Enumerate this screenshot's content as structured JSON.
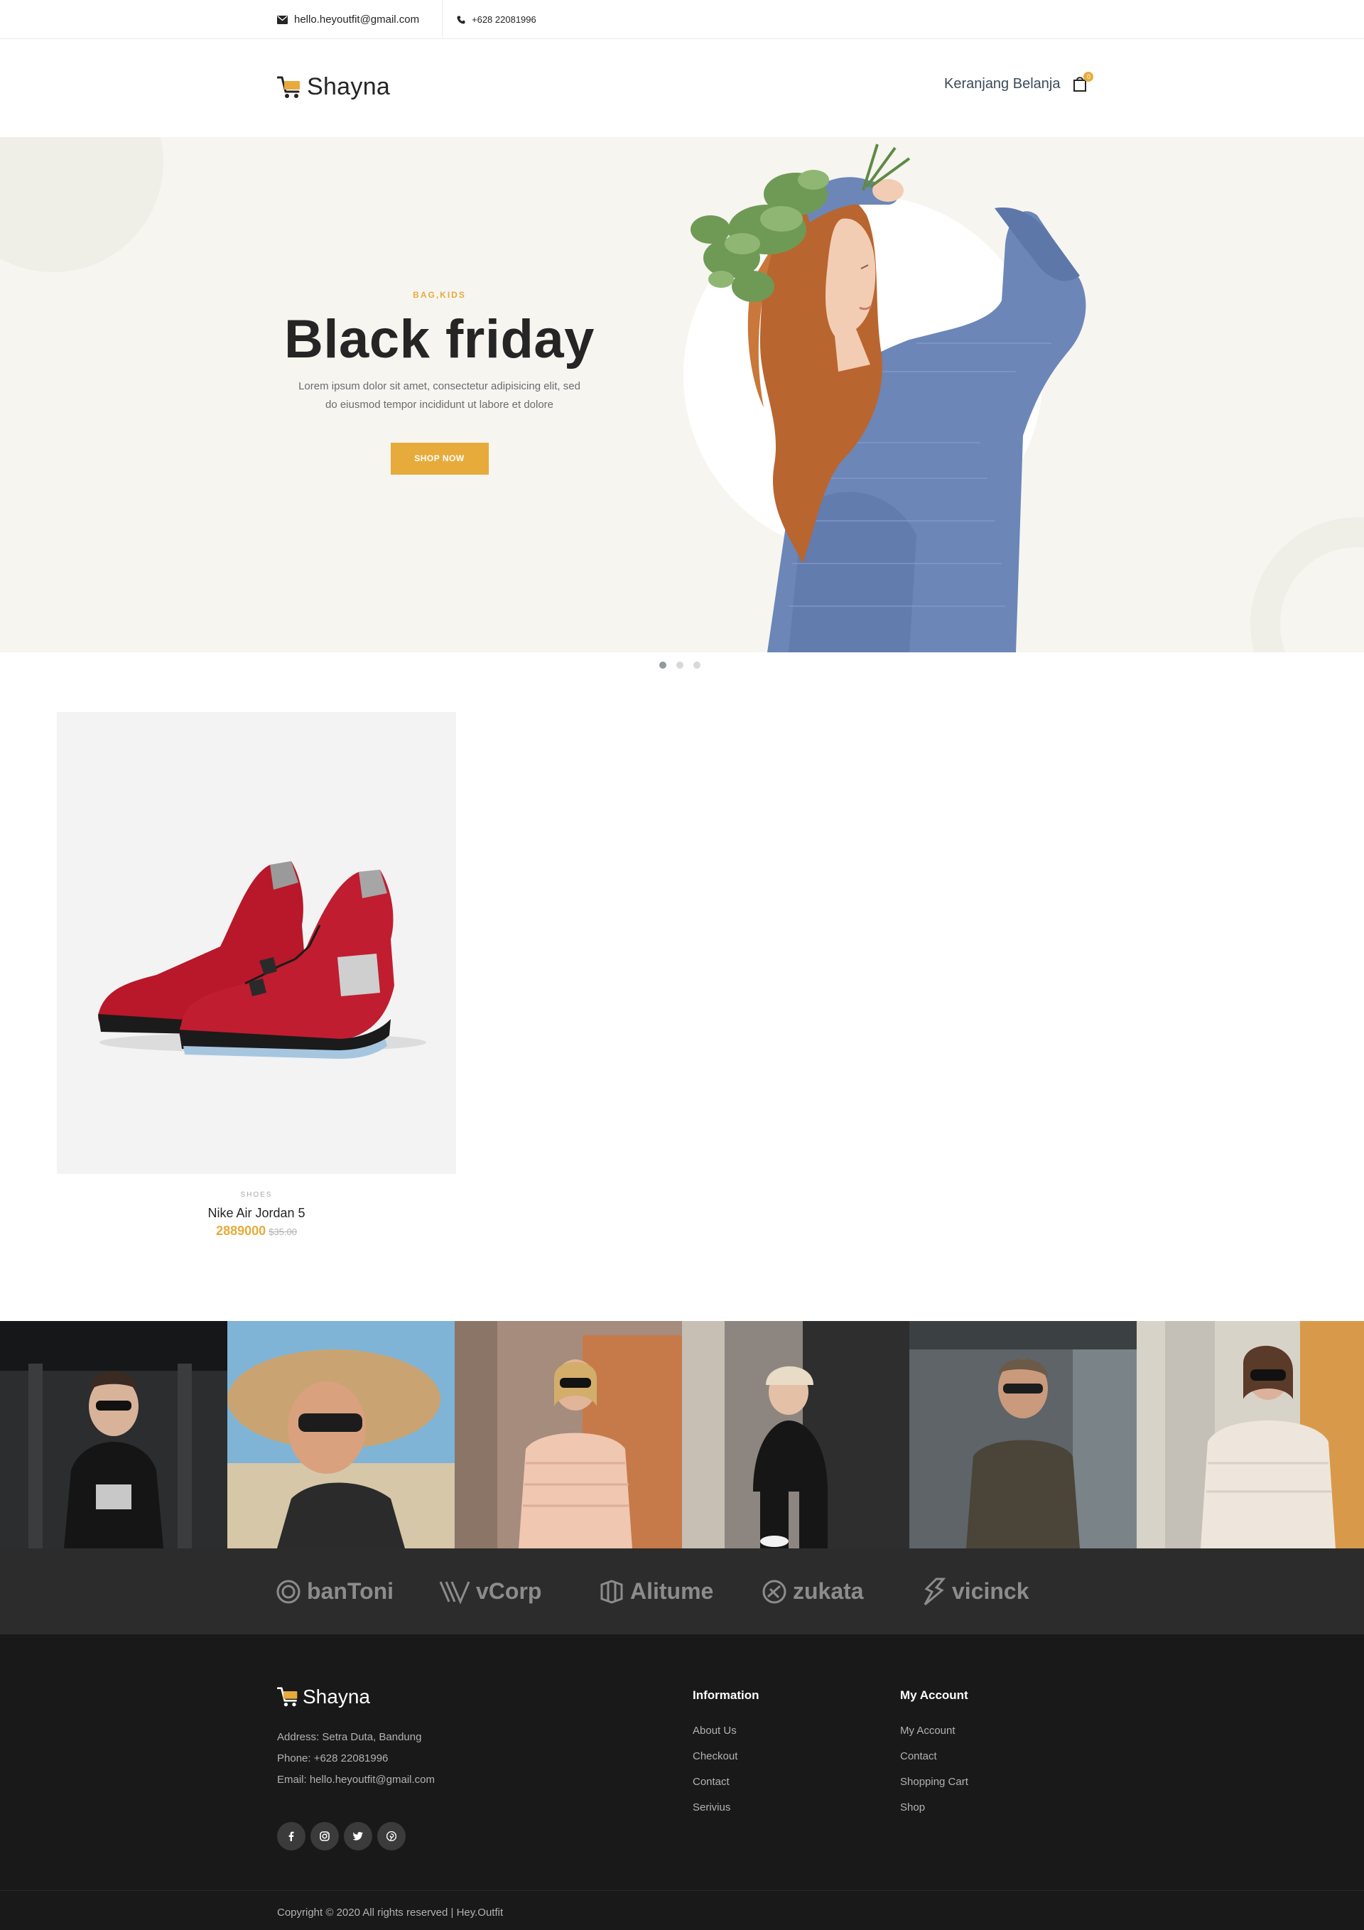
{
  "topbar": {
    "email": "hello.heyoutfit@gmail.com",
    "phone": "+628 22081996"
  },
  "header": {
    "logo_text": "Shayna",
    "cart_label": "Keranjang Belanja",
    "cart_count": "0"
  },
  "hero": {
    "category": "BAG,KIDS",
    "title": "Black friday",
    "description_line1": "Lorem ipsum dolor sit amet, consectetur adipisicing elit, sed",
    "description_line2": "do eiusmod tempor incididunt ut labore et dolore",
    "button_label": "SHOP NOW",
    "active_slide": 1,
    "slide_count": 3
  },
  "products": [
    {
      "category": "SHOES",
      "name": "Nike Air Jordan 5",
      "price": "2889000",
      "old_price": "$35.00"
    }
  ],
  "partners": [
    "banToni",
    "vCorp",
    "Alitume",
    "zukata",
    "vicinck"
  ],
  "footer": {
    "logo_text": "Shayna",
    "address": "Address: Setra Duta, Bandung",
    "phone": "Phone: +628 22081996",
    "email": "Email: hello.heyoutfit@gmail.com",
    "socials": [
      "facebook-icon",
      "instagram-icon",
      "twitter-icon",
      "pinterest-icon"
    ],
    "information": {
      "title": "Information",
      "links": [
        "About Us",
        "Checkout",
        "Contact",
        "Serivius"
      ]
    },
    "account": {
      "title": "My Account",
      "links": [
        "My Account",
        "Contact",
        "Shopping Cart",
        "Shop"
      ]
    },
    "copyright": "Copyright © 2020 All rights reserved | Hey.Outfit"
  },
  "colors": {
    "accent": "#e7ab3c",
    "hero_bg": "#f6f5f0",
    "footer_bg": "#191919",
    "partners_bg": "#2c2c2c"
  }
}
